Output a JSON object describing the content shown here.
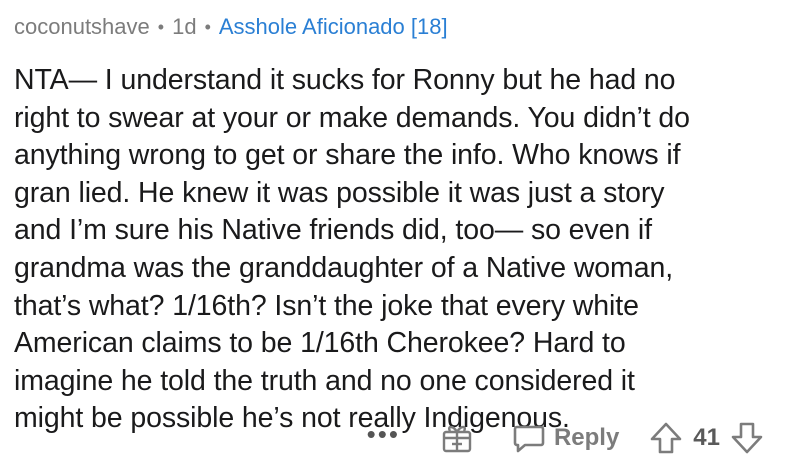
{
  "comment": {
    "username": "coconutshave",
    "separator": "•",
    "age": "1d",
    "flair": "Asshole Aficionado [18]",
    "body_lines": [
      "NTA— I understand it sucks for Ronny but he had no",
      "right to swear at your or make demands. You didn’t do",
      "anything wrong to get or share the info. Who knows if",
      "gran lied. He knew it was possible it was just a story",
      "and I’m sure his Native friends did, too— so even if",
      "grandma was the granddaughter of a Native woman,",
      "that’s what? 1/16th? Isn’t the joke that every white",
      "American claims to be 1/16th Cherokee? Hard to",
      "imagine he told the truth and no one considered it",
      "might be possible he’s not really Indigenous."
    ]
  },
  "actions": {
    "more_label": "•••",
    "reply_label": "Reply",
    "score": "41"
  },
  "colors": {
    "meta_gray": "#7c7c7c",
    "flair_blue": "#2a7fd4",
    "body_text": "#1a1a1b"
  },
  "icons": {
    "more": "more-options-icon",
    "gift": "gift-award-icon",
    "reply": "speech-bubble-icon",
    "upvote": "upvote-arrow-icon",
    "downvote": "downvote-arrow-icon"
  }
}
